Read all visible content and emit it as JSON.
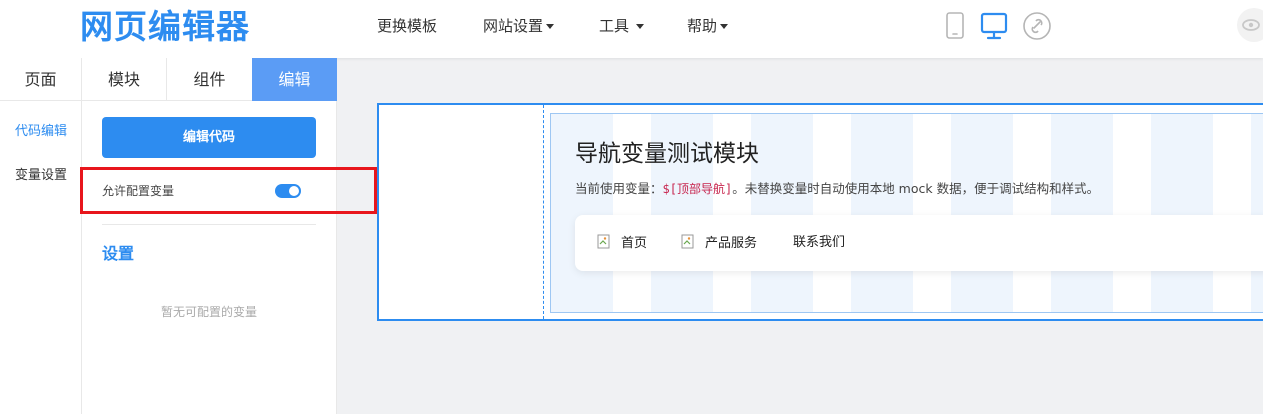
{
  "header": {
    "logo": "网页编辑器",
    "nav": [
      {
        "label": "更换模板",
        "dropdown": false
      },
      {
        "label": "网站设置",
        "dropdown": true
      },
      {
        "label": "工具",
        "dropdown": true
      },
      {
        "label": "帮助",
        "dropdown": true
      }
    ],
    "device_icons": [
      "mobile-icon",
      "desktop-icon",
      "link-icon"
    ]
  },
  "tabs": [
    {
      "label": "页面",
      "active": false
    },
    {
      "label": "模块",
      "active": false
    },
    {
      "label": "组件",
      "active": false
    },
    {
      "label": "编辑",
      "active": true
    }
  ],
  "sidebar": {
    "items": [
      {
        "label": "代码编辑",
        "active": true
      },
      {
        "label": "变量设置",
        "active": false
      }
    ]
  },
  "panel": {
    "edit_code_button": "编辑代码",
    "allow_config_label": "允许配置变量",
    "allow_config_on": true,
    "settings_title": "设置",
    "empty_text": "暂无可配置的变量"
  },
  "canvas": {
    "module_title": "导航变量测试模块",
    "desc_prefix": "当前使用变量：",
    "desc_var": "$[顶部导航]",
    "desc_suffix": "。未替换变量时自动使用本地 mock 数据，便于调试结构和样式。",
    "nav_links": [
      "首页",
      "产品服务",
      "联系我们"
    ]
  },
  "colors": {
    "accent": "#2d8cf0",
    "active_tab": "#5b9cf5",
    "highlight": "#e8161c"
  }
}
